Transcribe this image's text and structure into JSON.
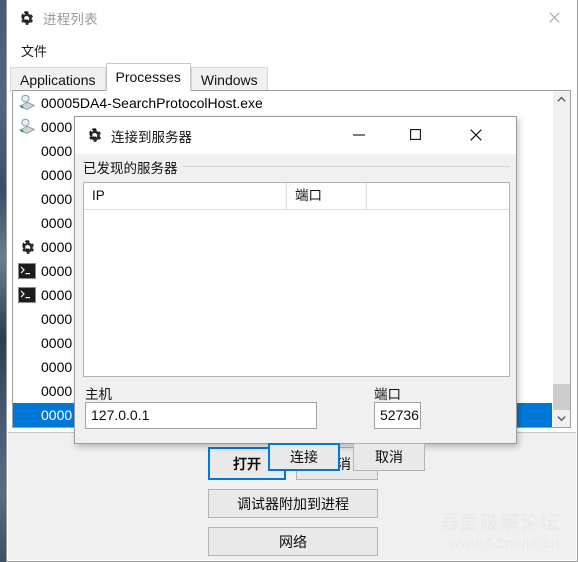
{
  "main_window": {
    "title": "进程列表",
    "icon": "gear-app-icon",
    "caption": {
      "close": "✕"
    },
    "menu": [
      {
        "label": "文件"
      }
    ],
    "tabs": [
      {
        "label": "Applications",
        "active": false
      },
      {
        "label": "Processes",
        "active": true
      },
      {
        "label": "Windows",
        "active": false
      }
    ],
    "process_list": {
      "rows": [
        {
          "icon": "server-icon",
          "label": "00005DA4-SearchProtocolHost.exe",
          "selected": false
        },
        {
          "icon": "server-icon",
          "label": "0000",
          "selected": false
        },
        {
          "icon": "none",
          "label": "0000",
          "selected": false
        },
        {
          "icon": "none",
          "label": "0000",
          "selected": false
        },
        {
          "icon": "none",
          "label": "0000",
          "selected": false
        },
        {
          "icon": "none",
          "label": "0000",
          "selected": false
        },
        {
          "icon": "gear-app-icon",
          "label": "0000",
          "selected": false
        },
        {
          "icon": "console-icon",
          "label": "0000",
          "selected": false
        },
        {
          "icon": "console-icon",
          "label": "0000",
          "selected": false
        },
        {
          "icon": "none",
          "label": "0000",
          "selected": false
        },
        {
          "icon": "none",
          "label": "0000",
          "selected": false
        },
        {
          "icon": "none",
          "label": "0000",
          "selected": false
        },
        {
          "icon": "none",
          "label": "0000",
          "selected": false
        },
        {
          "icon": "none",
          "label": "0000",
          "selected": true
        }
      ],
      "selection_color": "#0078d7",
      "scrollbar": {
        "up_arrow": "chevron-up-icon",
        "down_arrow": "chevron-down-icon",
        "thumb_position": "bottom"
      }
    },
    "buttons": {
      "open": "打开",
      "cancel": "取消",
      "attach": "调试器附加到进程",
      "network": "网络"
    }
  },
  "dialog": {
    "title": "连接到服务器",
    "icon": "gear-app-icon",
    "caption": {
      "minimize": "—",
      "maximize": "▢",
      "close": "✕"
    },
    "group_label": "已发现的服务器",
    "server_list": {
      "columns": [
        "IP",
        "端口",
        ""
      ],
      "rows": []
    },
    "host": {
      "label": "主机",
      "value": "127.0.0.1"
    },
    "port": {
      "label": "端口",
      "value": "52736"
    },
    "buttons": {
      "connect": "连接",
      "cancel": "取消"
    },
    "accent_color": "#0078d7"
  },
  "watermark": {
    "line1": "吾爱破解论坛",
    "line2": "www.52pojie.cn"
  }
}
